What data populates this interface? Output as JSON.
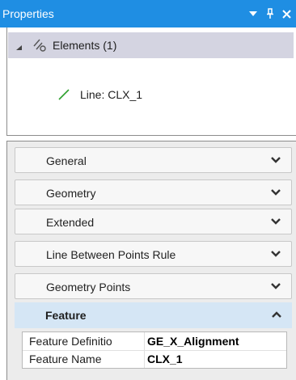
{
  "window": {
    "title": "Properties",
    "controls": [
      "dropdown-icon",
      "pin-icon",
      "close-icon"
    ],
    "accent": "#1f8ee3"
  },
  "tree": {
    "root": {
      "label": "Elements (1)",
      "icon": "elements-icon",
      "expanded": true
    },
    "child": {
      "label": "Line: CLX_1",
      "icon": "line-icon",
      "icon_color": "#2ca02c"
    }
  },
  "sections": [
    {
      "label": "General",
      "expanded": false
    },
    {
      "label": "Geometry",
      "expanded": false
    },
    {
      "label": "Extended",
      "expanded": false
    },
    {
      "label": "Line Between Points Rule",
      "expanded": false
    },
    {
      "label": "Geometry Points",
      "expanded": false
    }
  ],
  "feature": {
    "label": "Feature",
    "expanded": true,
    "rows": [
      {
        "key": "Feature Definitio",
        "value": "GE_X_Alignment"
      },
      {
        "key": "Feature Name",
        "value": "CLX_1"
      }
    ]
  }
}
